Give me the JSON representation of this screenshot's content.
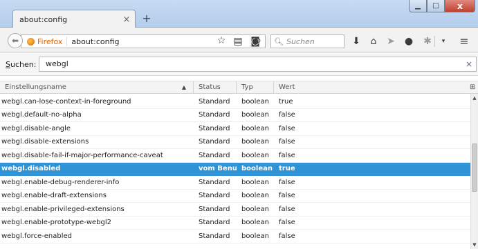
{
  "window": {
    "tab_title": "about:config",
    "tab_close_glyph": "×",
    "new_tab_glyph": "+",
    "minimize_glyph": "▁",
    "maximize_glyph": "□",
    "close_glyph": "x"
  },
  "navbar": {
    "identity_label": "Firefox",
    "url": "about:config",
    "search_placeholder": "Suchen",
    "icons": [
      "back-icon",
      "reload-icon",
      "bookmark-star-icon",
      "reading-list-icon",
      "pocket-icon",
      "search-icon",
      "download-icon",
      "home-icon",
      "share-icon",
      "chat-icon",
      "extension-icon",
      "dropdown-icon",
      "menu-icon"
    ]
  },
  "filter": {
    "label_underlined": "S",
    "label_rest": "uchen:",
    "value": "webgl",
    "clear_glyph": "×"
  },
  "table": {
    "headers": {
      "name": "Einstellungsname",
      "status": "Status",
      "type": "Typ",
      "value": "Wert"
    },
    "rows": [
      {
        "name": "webgl.can-lose-context-in-foreground",
        "status": "Standard",
        "type": "boolean",
        "value": "true"
      },
      {
        "name": "webgl.default-no-alpha",
        "status": "Standard",
        "type": "boolean",
        "value": "false"
      },
      {
        "name": "webgl.disable-angle",
        "status": "Standard",
        "type": "boolean",
        "value": "false"
      },
      {
        "name": "webgl.disable-extensions",
        "status": "Standard",
        "type": "boolean",
        "value": "false"
      },
      {
        "name": "webgl.disable-fail-if-major-performance-caveat",
        "status": "Standard",
        "type": "boolean",
        "value": "false"
      },
      {
        "name": "webgl.disabled",
        "status": "vom Benut...",
        "type": "boolean",
        "value": "true"
      },
      {
        "name": "webgl.enable-debug-renderer-info",
        "status": "Standard",
        "type": "boolean",
        "value": "false"
      },
      {
        "name": "webgl.enable-draft-extensions",
        "status": "Standard",
        "type": "boolean",
        "value": "false"
      },
      {
        "name": "webgl.enable-privileged-extensions",
        "status": "Standard",
        "type": "boolean",
        "value": "false"
      },
      {
        "name": "webgl.enable-prototype-webgl2",
        "status": "Standard",
        "type": "boolean",
        "value": "false"
      },
      {
        "name": "webgl.force-enabled",
        "status": "Standard",
        "type": "boolean",
        "value": "false"
      }
    ]
  },
  "colors": {
    "selection": "#2f93d5",
    "brand": "#e66000"
  }
}
